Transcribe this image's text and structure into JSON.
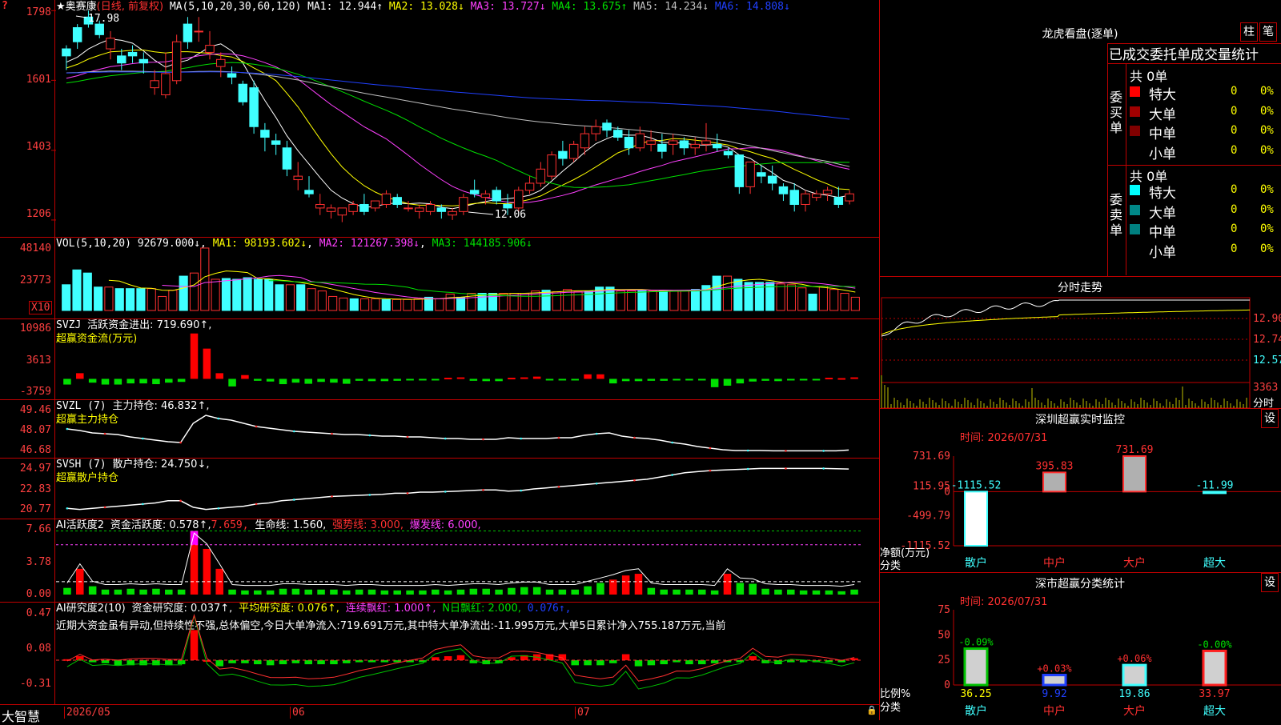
{
  "app": {
    "corner_icon": "?",
    "brand": "大智慧",
    "lock_icon": "🔒"
  },
  "main": {
    "title": "★奥赛康",
    "mode": "(日线, 前复权)",
    "ma_label": "MA(5,10,20,30,60,120)",
    "ma1": "MA1: 12.944↑",
    "ma2": "MA2: 13.028↓",
    "ma3": "MA3: 13.727↓",
    "ma4": "MA4: 13.675↑",
    "ma5": "MA5: 14.234↓",
    "ma6": "MA6: 14.808↓",
    "yticks": [
      "1798",
      "1601",
      "1403",
      "1206"
    ],
    "high_label": "17.98",
    "low_label": "12.06",
    "chart_data": {
      "type": "candlestick",
      "title": "奥赛康",
      "ylim": [
        11.9,
        18.1
      ],
      "candles": [
        [
          16.9,
          17.0,
          16.3,
          16.7
        ],
        [
          17.5,
          17.6,
          16.9,
          17.1
        ],
        [
          17.8,
          17.98,
          17.5,
          17.6
        ],
        [
          17.6,
          17.7,
          17.2,
          17.3
        ],
        [
          16.9,
          17.4,
          16.6,
          17.2
        ],
        [
          16.7,
          16.9,
          16.3,
          16.5
        ],
        [
          16.8,
          17.0,
          16.5,
          16.7
        ],
        [
          16.6,
          16.8,
          16.2,
          16.5
        ],
        [
          15.8,
          16.3,
          15.6,
          16.0
        ],
        [
          15.6,
          16.8,
          15.5,
          16.2
        ],
        [
          16.0,
          17.3,
          15.9,
          17.1
        ],
        [
          17.6,
          17.8,
          16.9,
          17.1
        ],
        [
          17.4,
          17.8,
          17.1,
          17.4
        ],
        [
          16.8,
          17.4,
          16.6,
          17.0
        ],
        [
          16.4,
          16.8,
          16.1,
          16.6
        ],
        [
          16.2,
          16.4,
          15.9,
          16.1
        ],
        [
          15.9,
          16.0,
          15.3,
          15.4
        ],
        [
          15.8,
          16.0,
          14.5,
          14.7
        ],
        [
          14.6,
          14.8,
          14.0,
          14.4
        ],
        [
          14.3,
          14.5,
          13.9,
          14.2
        ],
        [
          14.1,
          14.3,
          13.3,
          13.5
        ],
        [
          13.2,
          13.7,
          12.9,
          13.3
        ],
        [
          12.9,
          13.3,
          12.7,
          12.8
        ],
        [
          12.4,
          12.8,
          12.2,
          12.5
        ],
        [
          12.3,
          12.5,
          12.1,
          12.4
        ],
        [
          12.2,
          12.4,
          12.0,
          12.4
        ],
        [
          12.3,
          12.6,
          12.2,
          12.5
        ],
        [
          12.5,
          12.8,
          12.2,
          12.3
        ],
        [
          12.4,
          12.6,
          12.3,
          12.6
        ],
        [
          12.5,
          12.9,
          12.4,
          12.8
        ],
        [
          12.7,
          12.8,
          12.4,
          12.5
        ],
        [
          12.4,
          12.6,
          12.3,
          12.4
        ],
        [
          12.3,
          12.5,
          12.1,
          12.4
        ],
        [
          12.3,
          12.6,
          12.2,
          12.5
        ],
        [
          12.4,
          12.5,
          12.1,
          12.3
        ],
        [
          12.2,
          12.4,
          12.06,
          12.3
        ],
        [
          12.3,
          12.8,
          12.2,
          12.7
        ],
        [
          12.9,
          13.2,
          12.7,
          12.8
        ],
        [
          12.7,
          12.9,
          12.5,
          12.8
        ],
        [
          12.9,
          13.0,
          12.5,
          12.6
        ],
        [
          12.5,
          12.8,
          12.2,
          12.4
        ],
        [
          12.4,
          13.0,
          12.3,
          12.9
        ],
        [
          12.9,
          13.3,
          12.8,
          13.1
        ],
        [
          13.1,
          13.7,
          13.0,
          13.5
        ],
        [
          13.3,
          14.0,
          13.2,
          13.9
        ],
        [
          14.0,
          14.3,
          13.6,
          13.8
        ],
        [
          13.8,
          14.3,
          13.7,
          14.2
        ],
        [
          14.1,
          14.7,
          13.9,
          14.5
        ],
        [
          14.5,
          14.9,
          14.3,
          14.7
        ],
        [
          14.8,
          14.9,
          14.4,
          14.6
        ],
        [
          14.6,
          14.7,
          14.3,
          14.4
        ],
        [
          14.4,
          14.6,
          13.9,
          14.1
        ],
        [
          14.1,
          14.7,
          14.0,
          14.5
        ],
        [
          14.2,
          14.6,
          14.0,
          14.3
        ],
        [
          14.2,
          14.5,
          13.8,
          14.0
        ],
        [
          14.2,
          14.5,
          13.9,
          14.3
        ],
        [
          14.3,
          14.4,
          13.9,
          14.1
        ],
        [
          14.1,
          14.4,
          13.9,
          14.2
        ],
        [
          14.2,
          14.8,
          14.0,
          14.3
        ],
        [
          14.2,
          14.5,
          14.0,
          14.1
        ],
        [
          14.0,
          14.1,
          13.8,
          13.9
        ],
        [
          13.9,
          13.9,
          12.8,
          13.0
        ],
        [
          13.0,
          13.7,
          12.8,
          13.7
        ],
        [
          13.4,
          13.6,
          13.1,
          13.3
        ],
        [
          13.3,
          13.6,
          12.9,
          13.1
        ],
        [
          13.0,
          13.1,
          12.6,
          12.8
        ],
        [
          12.9,
          13.1,
          12.3,
          12.5
        ],
        [
          12.5,
          12.9,
          12.3,
          12.8
        ],
        [
          12.7,
          12.9,
          12.6,
          12.8
        ],
        [
          12.8,
          13.0,
          12.6,
          12.9
        ],
        [
          12.7,
          13.0,
          12.4,
          12.5
        ],
        [
          12.6,
          12.9,
          12.5,
          12.8
        ]
      ]
    }
  },
  "vol": {
    "label": "VOL(5,10,20)",
    "value": "92679.000↓",
    "ma1": "MA1: 98193.602↓",
    "ma2": "MA2: 121267.398↓",
    "ma3": "MA3: 144185.906↓",
    "yticks": [
      "48140",
      "23773"
    ],
    "unit": "X10",
    "chart_data": {
      "type": "bar",
      "values": [
        33,
        52,
        48,
        30,
        30,
        28,
        28,
        28,
        28,
        18,
        26,
        44,
        48,
        80,
        40,
        41,
        40,
        42,
        40,
        40,
        33,
        33,
        33,
        28,
        25,
        18,
        16,
        15,
        15,
        15,
        14,
        14,
        14,
        15,
        17,
        15,
        21,
        17,
        22,
        22,
        22,
        22,
        22,
        22,
        25,
        26,
        24,
        27,
        24,
        25,
        30,
        30,
        25,
        25,
        25,
        25,
        25,
        25,
        25,
        27,
        32,
        44,
        44,
        40,
        36,
        36,
        36,
        34,
        33,
        29,
        21,
        31,
        27,
        22,
        17
      ]
    }
  },
  "svzj": {
    "label": "SVZJ",
    "title": "活跃资金进出: 719.690↑,",
    "sub": "超赢资金流(万元)",
    "yticks": [
      "10986",
      "3613",
      "-3759"
    ],
    "chart_data": {
      "type": "bar",
      "values": [
        -1.5,
        1.5,
        -1,
        -1.5,
        -1.5,
        -1.2,
        -1.2,
        -1.4,
        -1,
        -0.8,
        12,
        8,
        1.5,
        -2,
        1,
        -0.5,
        -0.7,
        -1.4,
        -1,
        -1.3,
        -0.8,
        -1,
        -1.3,
        -0.5,
        -0.6,
        -0.6,
        -0.5,
        -0.4,
        -0.3,
        -0.4,
        0.3,
        0.4,
        -0.5,
        -0.6,
        -0.6,
        0.3,
        0.4,
        0.6,
        -0.3,
        -0.3,
        -0.3,
        1.2,
        1.2,
        -1.2,
        -0.6,
        -0.6,
        -0.5,
        -0.5,
        -0.4,
        -0.3,
        -0.4,
        -2.2,
        -1.8,
        -1.2,
        -0.7,
        -0.5,
        -0.6,
        -0.4,
        -0.3,
        -0.2,
        0.3,
        0.2,
        0.4
      ]
    }
  },
  "svzl": {
    "label": "SVZL (7)",
    "title": "主力持仓: 46.832↑,",
    "sub": "超赢主力持仓",
    "yticks": [
      "49.46",
      "48.07",
      "46.68"
    ],
    "chart_data": {
      "type": "line",
      "ylim": [
        46.6,
        49.6
      ],
      "values": [
        48.15,
        48.05,
        47.9,
        47.85,
        47.8,
        47.65,
        47.55,
        47.45,
        47.35,
        47.3,
        48.5,
        49.0,
        48.8,
        48.7,
        48.5,
        48.3,
        48.2,
        48.1,
        48.0,
        47.95,
        47.9,
        47.85,
        47.8,
        47.8,
        47.75,
        47.7,
        47.7,
        47.65,
        47.65,
        47.6,
        47.55,
        47.55,
        47.5,
        47.5,
        47.5,
        47.6,
        47.55,
        47.55,
        47.55,
        47.6,
        47.6,
        47.75,
        47.85,
        47.9,
        47.7,
        47.6,
        47.55,
        47.45,
        47.3,
        47.2,
        47.05,
        46.95,
        46.85,
        46.8,
        46.8,
        46.8,
        46.78,
        46.78,
        46.78,
        46.78,
        46.78,
        46.78,
        46.83
      ]
    }
  },
  "svsh": {
    "label": "SVSH (7)",
    "title": "散户持仓: 24.750↓,",
    "sub": "超赢散户持仓",
    "yticks": [
      "24.97",
      "22.83",
      "20.77"
    ],
    "chart_data": {
      "type": "line",
      "ylim": [
        20.6,
        25.2
      ],
      "values": [
        21.1,
        21.0,
        21.1,
        21.2,
        21.3,
        21.4,
        21.5,
        21.6,
        21.8,
        21.8,
        21.2,
        21.0,
        21.1,
        21.2,
        21.3,
        21.5,
        21.6,
        21.8,
        21.9,
        22.0,
        22.1,
        22.2,
        22.25,
        22.3,
        22.35,
        22.4,
        22.5,
        22.5,
        22.6,
        22.6,
        22.65,
        22.7,
        22.75,
        22.8,
        22.8,
        22.7,
        22.75,
        22.9,
        23.0,
        23.1,
        23.2,
        23.3,
        23.4,
        23.5,
        23.6,
        23.7,
        23.8,
        24.0,
        24.2,
        24.4,
        24.5,
        24.6,
        24.65,
        24.7,
        24.75,
        24.8,
        24.8,
        24.8,
        24.8,
        24.8,
        24.8,
        24.78,
        24.75
      ]
    }
  },
  "ai1": {
    "label": "AI活跃度2",
    "t1": "资金活跃度: 0.578↑,",
    "t2": "7.659,",
    "t3": "生命线: 1.560,",
    "t4": "强势线: 3.000,",
    "t5": "爆发线: 6.000,",
    "yticks": [
      "7.66",
      "3.78",
      "0.00"
    ],
    "chart_data": {
      "type": "bar",
      "ylim": [
        0,
        8
      ],
      "values": [
        0.8,
        3.1,
        1,
        0.6,
        0.6,
        0.7,
        0.6,
        0.7,
        0.6,
        0.6,
        7.66,
        5.5,
        3.1,
        0.6,
        0.5,
        0.5,
        0.5,
        0.7,
        0.7,
        0.6,
        0.6,
        0.6,
        0.5,
        0.6,
        0.6,
        0.5,
        0.5,
        0.5,
        0.5,
        0.6,
        0.5,
        0.6,
        0.7,
        0.7,
        0.6,
        0.8,
        0.9,
        0.9,
        0.6,
        0.6,
        0.6,
        1,
        1.4,
        1.8,
        2.3,
        2.5,
        0.8,
        0.6,
        0.6,
        0.6,
        0.6,
        0.5,
        2.5,
        1.4,
        1.3,
        0.7,
        0.6,
        0.6,
        0.5,
        0.5,
        0.5,
        0.4,
        0.6
      ]
    }
  },
  "ai2": {
    "label": "AI研究度2(10)",
    "t1": "资金研究度: 0.037↑,",
    "t2": "平均研究度: 0.076↑,",
    "t3": "连续飘红: 1.000↑,",
    "t4": "N日飘红: 2.000,",
    "t5": "0.076↑,",
    "text": "近期大资金虽有异动,但持续性不强,总体偏空,今日大单净流入:719.691万元,其中特大单净流出:-11.995万元,大单5日累计净入755.187万元,当前",
    "yticks": [
      "0.47",
      "0.08",
      "-0.31"
    ],
    "chart_data": {
      "type": "bar",
      "ylim": [
        -0.31,
        0.47
      ],
      "values": [
        0.01,
        0.04,
        -0.02,
        -0.03,
        -0.05,
        -0.05,
        -0.05,
        -0.05,
        -0.05,
        -0.04,
        0.3,
        0.0,
        -0.06,
        -0.03,
        -0.03,
        -0.04,
        -0.05,
        -0.04,
        -0.03,
        -0.04,
        -0.04,
        -0.04,
        -0.03,
        -0.02,
        -0.02,
        -0.02,
        -0.02,
        -0.02,
        -0.02,
        0.03,
        0.04,
        0.05,
        -0.03,
        -0.04,
        -0.03,
        0.03,
        0.05,
        0.06,
        0.06,
        0.06,
        -0.05,
        -0.05,
        -0.05,
        -0.03,
        0.06,
        -0.06,
        -0.05,
        -0.04,
        -0.02,
        -0.04,
        -0.04,
        -0.03,
        -0.02,
        -0.02,
        0.04,
        -0.03,
        -0.04,
        -0.02,
        -0.02,
        -0.02,
        -0.02,
        -0.02,
        0.02
      ]
    }
  },
  "xaxis": {
    "labels": [
      "2026/05",
      "06",
      "07"
    ]
  },
  "right": {
    "lhkp_title": "龙虎看盘(逐单)",
    "btn_zhu": "柱",
    "btn_bi": "笔",
    "stats_title": "已成交委托单成交量统计",
    "buy_total": "共 0单",
    "sell_total": "共 0单",
    "buy_side": "委买单",
    "sell_side": "委卖单",
    "rows": [
      {
        "name": "特大",
        "val": "0",
        "pct": "0%",
        "buy_color": "#ff0000",
        "sell_color": "#00ffff"
      },
      {
        "name": "大单",
        "val": "0",
        "pct": "0%",
        "buy_color": "#a00000",
        "sell_color": "#008888"
      },
      {
        "name": "中单",
        "val": "0",
        "pct": "0%",
        "buy_color": "#800000",
        "sell_color": "#008080"
      },
      {
        "name": "小单",
        "val": "0",
        "pct": "0%",
        "buy_color": "#000000",
        "sell_color": "#000000"
      }
    ],
    "fenshi_title": "分时走势",
    "fenshi_yticks": [
      "12.90",
      "12.74",
      "12.57"
    ],
    "fenshi_vol": "3363",
    "fenshi_unit": "分时",
    "monitor_title": "深圳超赢实时监控",
    "btn_set": "设",
    "monitor_time": "时间: 2026/07/31",
    "monitor_yticks": [
      "731.69",
      "115.95",
      "0",
      "-499.79",
      "-1115.52"
    ],
    "monitor_ylabel": "净额(万元)",
    "monitor_xlabel": "分类",
    "monitor_chart": {
      "type": "bar",
      "categories": [
        "散户",
        "中户",
        "大户",
        "超大"
      ],
      "values": [
        -1115.52,
        395.83,
        731.69,
        -11.99
      ],
      "labels": [
        "-1115.52",
        "395.83",
        "731.69",
        "-11.99"
      ]
    },
    "class_title": "深市超赢分类统计",
    "class_time": "时间: 2026/07/31",
    "class_yticks": [
      "75",
      "50",
      "25",
      "0"
    ],
    "class_ylabel": "比例%",
    "class_xlabel": "分类",
    "class_chart": {
      "type": "bar",
      "categories": [
        "散户",
        "中户",
        "大户",
        "超大"
      ],
      "values": [
        36.25,
        9.92,
        19.86,
        33.97
      ],
      "changes": [
        "-0.09%",
        "+0.03%",
        "+0.06%",
        "-0.00%"
      ],
      "values_text": [
        "36.25",
        "9.92",
        "19.86",
        "33.97"
      ]
    }
  }
}
